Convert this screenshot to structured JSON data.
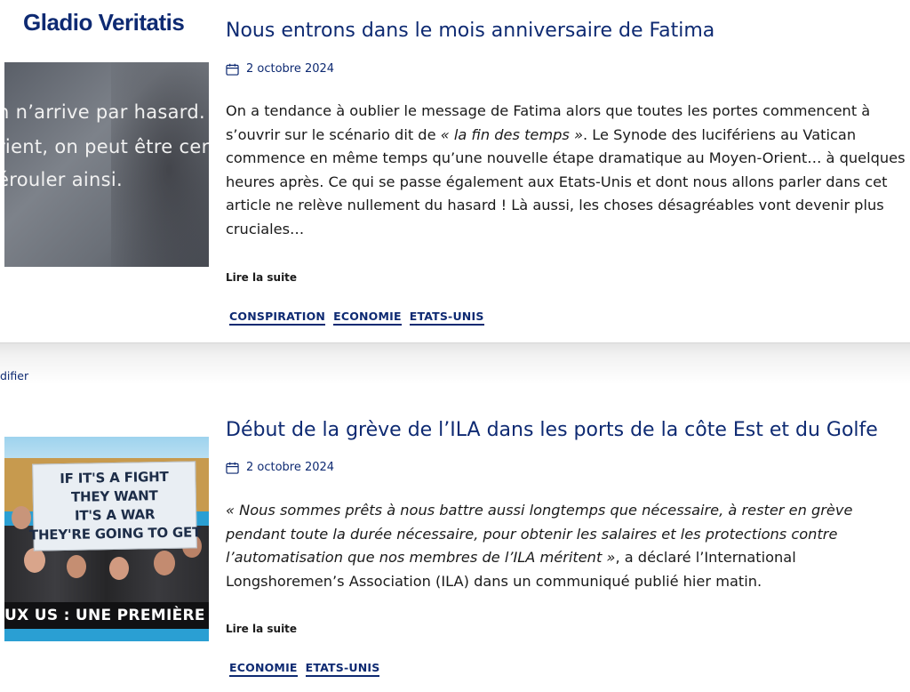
{
  "site": {
    "title": "Gladio Veritatis"
  },
  "posts": [
    {
      "title": "Nous entrons dans le mois anniversaire de Fatima",
      "date": "2 octobre 2024",
      "excerpt": {
        "part1": "On a tendance à oublier le message de Fatima alors que toutes les portes commencent à s’ouvrir sur le scénario dit de ",
        "italic": "« la fin des temps »",
        "part2": ". Le Synode des lucifériens au Vatican commence en même temps qu’une nouvelle étape dramatique au Moyen-Orient… à quelques heures après. Ce qui se passe également aux Etats-Unis et dont nous allons parler dans cet article ne relève nullement du hasard ! Là aussi, les choses désagréables vont devenir plus cruciales…"
      },
      "read_more": "Lire la suite",
      "tags": [
        "CONSPIRATION",
        "ECONOMIE",
        "ETATS-UNIS"
      ],
      "thumbnail": {
        "lines": [
          "n n’arrive par hasard. C",
          "rient, on peut être certa",
          "érouler ainsi."
        ]
      }
    },
    {
      "title": "Début de la grève de l’ILA dans les ports de la côte Est et du Golfe",
      "date": "2 octobre 2024",
      "excerpt": {
        "italic": "« Nous sommes prêts à nous battre aussi longtemps que nécessaire, à rester en grève pendant toute la durée nécessaire, pour obtenir les salaires et les protections contre l’automatisation que nos membres de l’ILA méritent »",
        "part2": ", a déclaré l’International Longshoremen’s Association (ILA) dans un communiqué publié hier matin."
      },
      "read_more": "Lire la suite",
      "tags": [
        "ECONOMIE",
        "ETATS-UNIS"
      ],
      "thumbnail": {
        "sign_lines": [
          "IF IT'S A FIGHT",
          "THEY WANT",
          "IT'S A WAR",
          "THEY'RE GOING TO GET"
        ],
        "banner": "UX US : UNE PREMIÈRE DEP"
      }
    }
  ],
  "edit_link": "difier",
  "icons": {
    "date": "calendar-icon"
  },
  "colors": {
    "accent": "#0e2a72",
    "text": "#1a1a1a"
  }
}
